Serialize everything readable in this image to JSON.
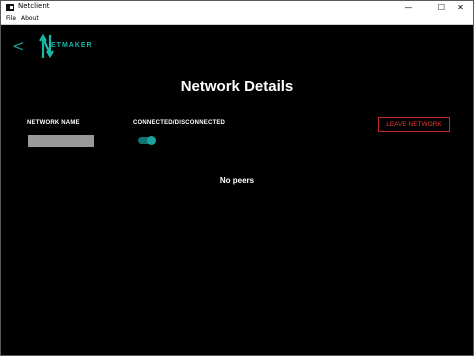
{
  "window": {
    "title": "Netclient",
    "minimize": "—",
    "maximize": "☐",
    "close": "✕"
  },
  "menu": {
    "items": [
      "File",
      "About"
    ]
  },
  "nav": {
    "back": "<"
  },
  "logo": {
    "text": "ETMAKER"
  },
  "page": {
    "title": "Network Details"
  },
  "fields": {
    "network_name_label": "NETWORK NAME",
    "connected_label": "CONNECTED/DISCONNECTED",
    "connected": true
  },
  "actions": {
    "leave": "LEAVE NETWORK"
  },
  "peers": {
    "empty_text": "No peers"
  },
  "colors": {
    "accent": "#17b8a6",
    "danger": "#e53935",
    "background": "#000000"
  }
}
